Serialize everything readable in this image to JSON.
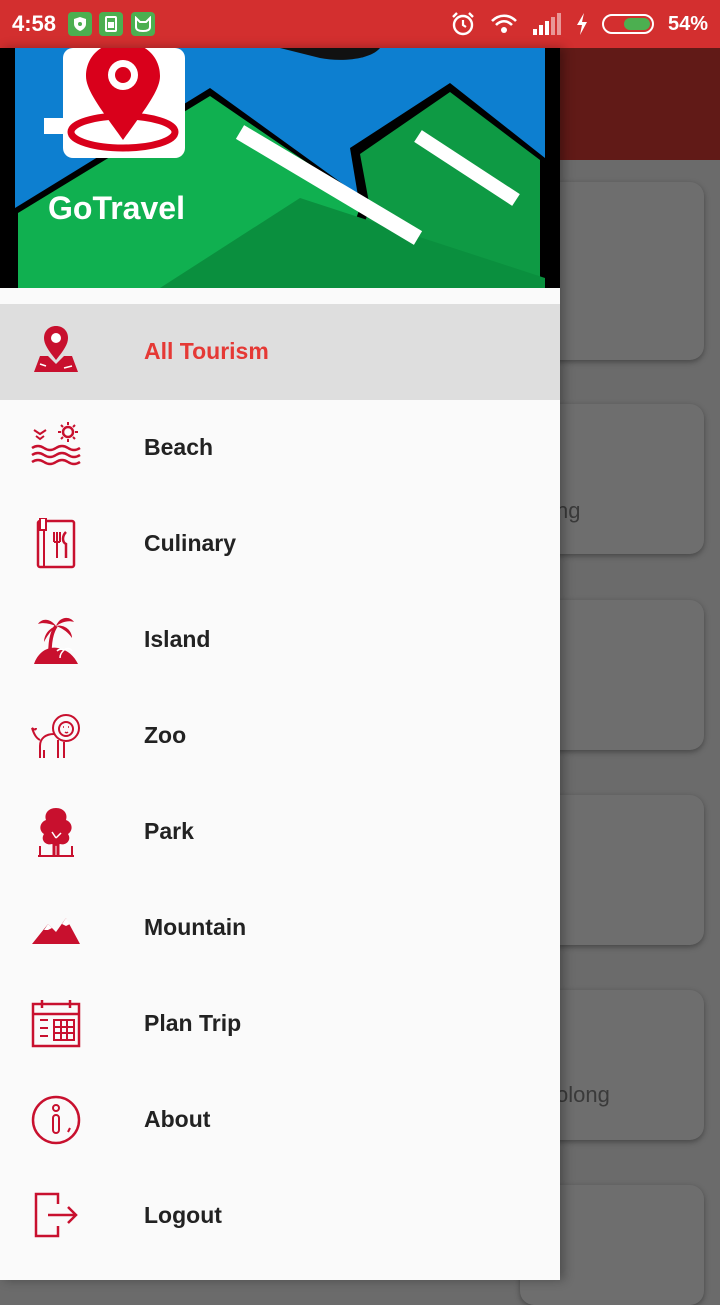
{
  "status_bar": {
    "time": "4:58",
    "battery_pct": "54%",
    "battery_level": 0.54,
    "notification_icons": [
      "shield-icon",
      "sim-icon",
      "cat-icon"
    ],
    "system_icons": [
      "alarm-icon",
      "wifi-icon",
      "signal-icon",
      "charging-icon",
      "battery-icon"
    ]
  },
  "drawer": {
    "app_name": "GoTravel",
    "accent_color": "#e53935",
    "icon_color": "#c8102e",
    "items": [
      {
        "label": "All Tourism",
        "icon": "map-pin-icon",
        "selected": true
      },
      {
        "label": "Beach",
        "icon": "beach-waves-icon",
        "selected": false
      },
      {
        "label": "Culinary",
        "icon": "menu-book-icon",
        "selected": false
      },
      {
        "label": "Island",
        "icon": "palm-island-icon",
        "selected": false
      },
      {
        "label": "Zoo",
        "icon": "lion-icon",
        "selected": false
      },
      {
        "label": "Park",
        "icon": "tree-icon",
        "selected": false
      },
      {
        "label": "Mountain",
        "icon": "mountain-icon",
        "selected": false
      },
      {
        "label": "Plan Trip",
        "icon": "calendar-icon",
        "selected": false
      },
      {
        "label": "About",
        "icon": "info-icon",
        "selected": false
      },
      {
        "label": "Logout",
        "icon": "logout-icon",
        "selected": false
      }
    ]
  },
  "background": {
    "card_fragments": [
      "ng",
      "olong"
    ]
  }
}
